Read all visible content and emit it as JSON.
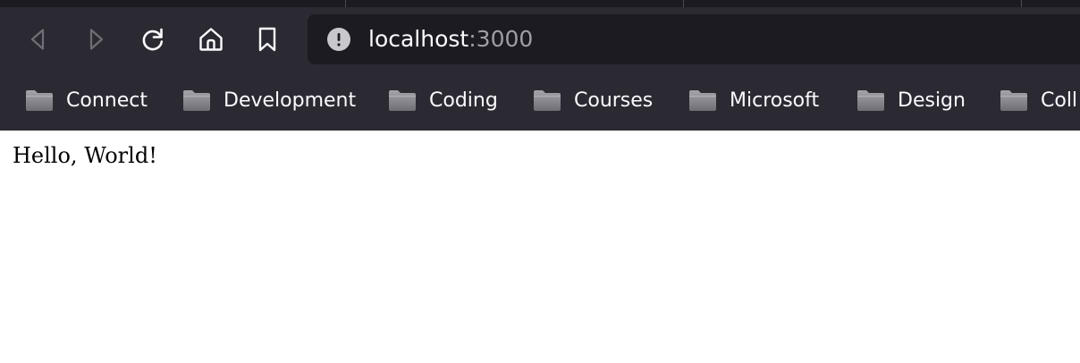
{
  "browser": {
    "url": {
      "host": "localhost",
      "port": ":3000"
    },
    "nav_icons": [
      "back-icon",
      "forward-icon",
      "reload-icon",
      "home-icon",
      "bookmark-icon"
    ],
    "colors": {
      "toolbar_bg": "#2b2a33",
      "urlbar_bg": "#1c1b22",
      "text": "#fbfbfe",
      "muted_text": "#9e9ea6"
    }
  },
  "bookmarks": [
    {
      "label": "Connect"
    },
    {
      "label": "Development"
    },
    {
      "label": "Coding"
    },
    {
      "label": "Courses"
    },
    {
      "label": "Microsoft"
    },
    {
      "label": "Design"
    },
    {
      "label": "Coll"
    }
  ],
  "page": {
    "text": "Hello, World!"
  }
}
